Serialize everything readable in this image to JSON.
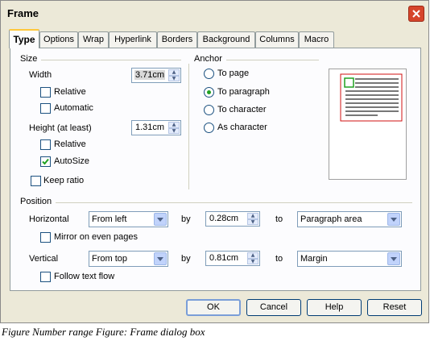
{
  "window": {
    "title": "Frame"
  },
  "tabs": [
    "Type",
    "Options",
    "Wrap",
    "Hyperlink",
    "Borders",
    "Background",
    "Columns",
    "Macro"
  ],
  "size": {
    "heading": "Size",
    "width_label": "Width",
    "width_value": "3.71cm",
    "width_relative": "Relative",
    "width_automatic": "Automatic",
    "height_label": "Height (at least)",
    "height_value": "1.31cm",
    "height_relative": "Relative",
    "height_autosize": "AutoSize",
    "keep_ratio": "Keep ratio"
  },
  "anchor": {
    "heading": "Anchor",
    "options": [
      "To page",
      "To paragraph",
      "To character",
      "As character"
    ],
    "selected": "To paragraph"
  },
  "position": {
    "heading": "Position",
    "horizontal_label": "Horizontal",
    "horizontal_value": "From left",
    "h_by_label": "by",
    "h_by_value": "0.28cm",
    "h_to_label": "to",
    "h_to_value": "Paragraph area",
    "mirror": "Mirror on even pages",
    "vertical_label": "Vertical",
    "vertical_value": "From top",
    "v_by_label": "by",
    "v_by_value": "0.81cm",
    "v_to_label": "to",
    "v_to_value": "Margin",
    "follow": "Follow text flow"
  },
  "buttons": {
    "ok": "OK",
    "cancel": "Cancel",
    "help": "Help",
    "reset": "Reset"
  },
  "caption": "Figure Number range Figure: Frame dialog box",
  "colors": {
    "accent_tab": "#ffc83c",
    "close": "#d6452b",
    "preview_frame": "#d01010",
    "anchor_marker": "#21a121"
  }
}
